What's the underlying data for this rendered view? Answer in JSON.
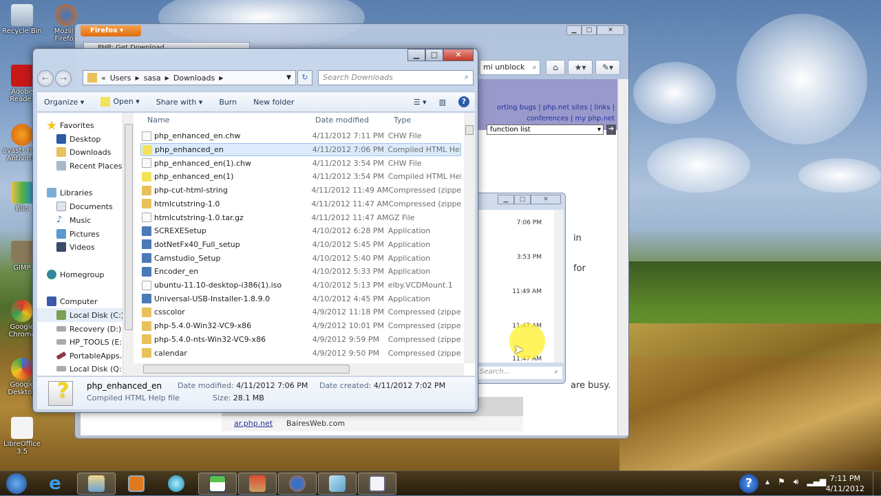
{
  "desktop": {
    "icons": [
      {
        "label": "Recycle Bin",
        "icon": "recycle-bin-icon"
      },
      {
        "label": "Mozilla Firefox",
        "icon": "firefox-icon"
      },
      {
        "label": "Adobe Reader",
        "icon": "adobe-reader-icon"
      },
      {
        "label": "avast! Free Antivirus",
        "icon": "avast-icon"
      },
      {
        "label": "Blio",
        "icon": "blio-icon"
      },
      {
        "label": "GIMP",
        "icon": "gimp-icon"
      },
      {
        "label": "Google Chrome",
        "icon": "chrome-icon"
      },
      {
        "label": "Google Desktop",
        "icon": "google-desktop-icon"
      },
      {
        "label": "LibreOffice 3.5",
        "icon": "libreoffice-icon"
      }
    ]
  },
  "firefox": {
    "menu_button": "Firefox",
    "tab_title": "PHP: Get Download",
    "search_value": "mi unblock",
    "nav_links_line1": "orting bugs | php.net sites | links |",
    "nav_links_line2": "conferences | my php.net",
    "function_list": "function list",
    "body_text_in": "in",
    "body_text_for": "for",
    "body_text_busy": "are busy.",
    "mirror_link": "ar.php.net",
    "mirror_provider": "BairesWeb.com"
  },
  "popup": {
    "times": [
      "7:06 PM",
      "3:53 PM",
      "11:49 AM",
      "11:47 AM",
      "11:47 AM"
    ],
    "search_placeholder": "Search..."
  },
  "explorer": {
    "breadcrumb": [
      "«",
      "Users",
      "sasa",
      "Downloads"
    ],
    "search_placeholder": "Search Downloads",
    "toolbar": {
      "organize": "Organize ▾",
      "open": "Open ▾",
      "share_with": "Share with ▾",
      "burn": "Burn",
      "new_folder": "New folder"
    },
    "nav": {
      "favorites": "Favorites",
      "desktop": "Desktop",
      "downloads": "Downloads",
      "recent": "Recent Places",
      "libraries": "Libraries",
      "documents": "Documents",
      "music": "Music",
      "pictures": "Pictures",
      "videos": "Videos",
      "homegroup": "Homegroup",
      "computer": "Computer",
      "c": "Local Disk (C:)",
      "d": "Recovery (D:)",
      "e": "HP_TOOLS (E:)",
      "portable": "PortableApps.com",
      "q": "Local Disk (Q:)"
    },
    "columns": {
      "name": "Name",
      "date": "Date modified",
      "type": "Type"
    },
    "files": [
      {
        "name": "php_enhanced_en.chw",
        "date": "4/11/2012 7:11 PM",
        "type": "CHW File",
        "kind": "file"
      },
      {
        "name": "php_enhanced_en",
        "date": "4/11/2012 7:06 PM",
        "type": "Compiled HTML Help file",
        "kind": "chm"
      },
      {
        "name": "php_enhanced_en(1).chw",
        "date": "4/11/2012 3:54 PM",
        "type": "CHW File",
        "kind": "file"
      },
      {
        "name": "php_enhanced_en(1)",
        "date": "4/11/2012 3:54 PM",
        "type": "Compiled HTML Help file",
        "kind": "chm"
      },
      {
        "name": "php-cut-html-string",
        "date": "4/11/2012 11:49 AM",
        "type": "Compressed (zipped) Folder",
        "kind": "zip"
      },
      {
        "name": "htmlcutstring-1.0",
        "date": "4/11/2012 11:47 AM",
        "type": "Compressed (zipped) Folder",
        "kind": "zip"
      },
      {
        "name": "htmlcutstring-1.0.tar.gz",
        "date": "4/11/2012 11:47 AM",
        "type": "GZ File",
        "kind": "file"
      },
      {
        "name": "SCREXESetup",
        "date": "4/10/2012 6:28 PM",
        "type": "Application",
        "kind": "app"
      },
      {
        "name": "dotNetFx40_Full_setup",
        "date": "4/10/2012 5:45 PM",
        "type": "Application",
        "kind": "app"
      },
      {
        "name": "Camstudio_Setup",
        "date": "4/10/2012 5:40 PM",
        "type": "Application",
        "kind": "app"
      },
      {
        "name": "Encoder_en",
        "date": "4/10/2012 5:33 PM",
        "type": "Application",
        "kind": "app"
      },
      {
        "name": "ubuntu-11.10-desktop-i386(1).iso",
        "date": "4/10/2012 5:13 PM",
        "type": "elby.VCDMount.1",
        "kind": "file"
      },
      {
        "name": "Universal-USB-Installer-1.8.9.0",
        "date": "4/10/2012 4:45 PM",
        "type": "Application",
        "kind": "app"
      },
      {
        "name": "csscolor",
        "date": "4/9/2012 11:18 PM",
        "type": "Compressed (zipped) Folder",
        "kind": "zip"
      },
      {
        "name": "php-5.4.0-Win32-VC9-x86",
        "date": "4/9/2012 10:01 PM",
        "type": "Compressed (zipped) Folder",
        "kind": "zip"
      },
      {
        "name": "php-5.4.0-nts-Win32-VC9-x86",
        "date": "4/9/2012 9:59 PM",
        "type": "Compressed (zipped) Folder",
        "kind": "zip"
      },
      {
        "name": "calendar",
        "date": "4/9/2012 9:50 PM",
        "type": "Compressed (zipped) Folder",
        "kind": "zip"
      }
    ],
    "selected_index": 1,
    "details": {
      "name": "php_enhanced_en",
      "type": "Compiled HTML Help file",
      "modified_label": "Date modified:",
      "modified": "4/11/2012 7:06 PM",
      "created_label": "Date created:",
      "created": "4/11/2012 7:02 PM",
      "size_label": "Size:",
      "size": "28.1 MB"
    }
  },
  "taskbar": {
    "items": [
      "start-button",
      "internet-explorer",
      "windows-explorer",
      "media-player",
      "camstudio",
      "hp-app",
      "remote-desktop",
      "firefox",
      "notepad",
      "video-recorder"
    ],
    "time": "7:11 PM",
    "date": "4/11/2012"
  },
  "colors": {
    "selection": "#dcebfc",
    "folder_zip": "#e8c15a",
    "link": "#223399",
    "php_purple": "#9999cc"
  }
}
